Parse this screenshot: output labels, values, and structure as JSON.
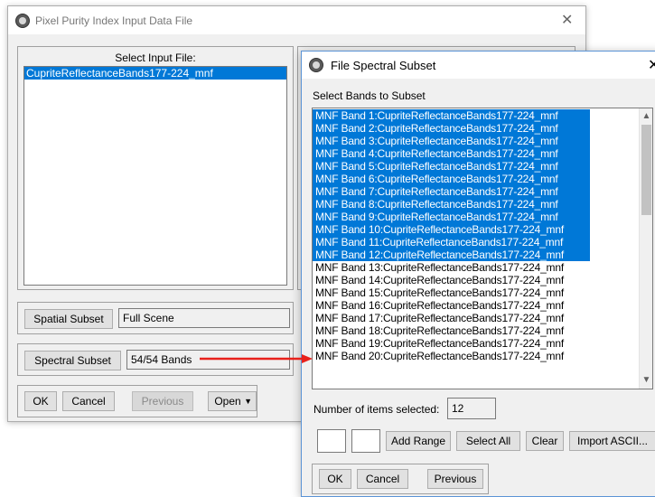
{
  "ppi_window": {
    "title": "Pixel Purity Index Input Data File",
    "select_input_label": "Select Input File:",
    "files": [
      "CupriteReflectanceBands177-224_mnf"
    ],
    "spatial_subset_button": "Spatial Subset",
    "spatial_subset_value": "Full Scene",
    "spectral_subset_button": "Spectral Subset",
    "spectral_subset_value": "54/54 Bands",
    "ok_button": "OK",
    "cancel_button": "Cancel",
    "previous_button": "Previous",
    "open_button": "Open"
  },
  "spectral_subset_window": {
    "title": "File Spectral Subset",
    "select_bands_label": "Select Bands to Subset",
    "bands": [
      {
        "label": "MNF Band 1:CupriteReflectanceBands177-224_mnf",
        "selected": true
      },
      {
        "label": "MNF Band 2:CupriteReflectanceBands177-224_mnf",
        "selected": true
      },
      {
        "label": "MNF Band 3:CupriteReflectanceBands177-224_mnf",
        "selected": true
      },
      {
        "label": "MNF Band 4:CupriteReflectanceBands177-224_mnf",
        "selected": true
      },
      {
        "label": "MNF Band 5:CupriteReflectanceBands177-224_mnf",
        "selected": true
      },
      {
        "label": "MNF Band 6:CupriteReflectanceBands177-224_mnf",
        "selected": true
      },
      {
        "label": "MNF Band 7:CupriteReflectanceBands177-224_mnf",
        "selected": true
      },
      {
        "label": "MNF Band 8:CupriteReflectanceBands177-224_mnf",
        "selected": true
      },
      {
        "label": "MNF Band 9:CupriteReflectanceBands177-224_mnf",
        "selected": true
      },
      {
        "label": "MNF Band 10:CupriteReflectanceBands177-224_mnf",
        "selected": true
      },
      {
        "label": "MNF Band 11:CupriteReflectanceBands177-224_mnf",
        "selected": true
      },
      {
        "label": "MNF Band 12:CupriteReflectanceBands177-224_mnf",
        "selected": true
      },
      {
        "label": "MNF Band 13:CupriteReflectanceBands177-224_mnf",
        "selected": false
      },
      {
        "label": "MNF Band 14:CupriteReflectanceBands177-224_mnf",
        "selected": false
      },
      {
        "label": "MNF Band 15:CupriteReflectanceBands177-224_mnf",
        "selected": false
      },
      {
        "label": "MNF Band 16:CupriteReflectanceBands177-224_mnf",
        "selected": false
      },
      {
        "label": "MNF Band 17:CupriteReflectanceBands177-224_mnf",
        "selected": false
      },
      {
        "label": "MNF Band 18:CupriteReflectanceBands177-224_mnf",
        "selected": false
      },
      {
        "label": "MNF Band 19:CupriteReflectanceBands177-224_mnf",
        "selected": false
      },
      {
        "label": "MNF Band 20:CupriteReflectanceBands177-224_mnf",
        "selected": false
      }
    ],
    "items_selected_label": "Number of items selected:",
    "items_selected_value": "12",
    "add_range_button": "Add Range",
    "select_all_button": "Select All",
    "clear_button": "Clear",
    "import_ascii_button": "Import ASCII...",
    "ok_button": "OK",
    "cancel_button": "Cancel",
    "previous_button": "Previous"
  },
  "colors": {
    "selection": "#0078d7",
    "annotation_arrow": "#e8211b"
  }
}
